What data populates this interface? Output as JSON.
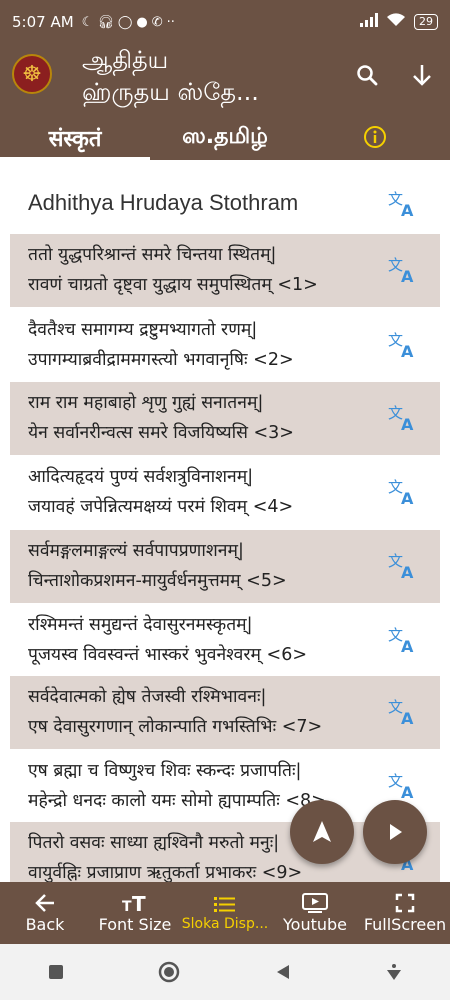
{
  "status_bar": {
    "time": "5:07 AM",
    "battery": "29"
  },
  "app_bar": {
    "title_line1": "ஆதித்ய",
    "title_line2": "ஹ்ருதய ஸ்தே..."
  },
  "tabs": [
    {
      "label": "संस्कृतं",
      "active": true
    },
    {
      "label": "ஸ.தமிழ்",
      "active": false
    }
  ],
  "heading": "Adhithya Hrudaya Stothram",
  "verses": [
    {
      "line1": "ततो युद्धपरिश्रान्तं समरे चिन्तया स्थितम्|",
      "line2": "रावणं चाग्रतो दृष्ट्वा युद्धाय समुपस्थितम् <1>"
    },
    {
      "line1": "दैवतैश्च समागम्य द्रष्टुमभ्यागतो रणम्|",
      "line2": "उपागम्याब्रवीद्राममगस्त्यो भगवानृषिः <2>"
    },
    {
      "line1": "राम राम महाबाहो शृणु गुह्यं सनातनम्|",
      "line2": "येन सर्वानरीन्वत्स समरे विजयिष्यसि <3>"
    },
    {
      "line1": "आदित्यहृदयं पुण्यं सर्वशत्रुविनाशनम्|",
      "line2": "जयावहं जपेन्नित्यमक्षय्यं परमं शिवम् <4>"
    },
    {
      "line1": "सर्वमङ्गलमाङ्गल्यं सर्वपापप्रणाशनम्|",
      "line2": "चिन्ताशोकप्रशमन-मायुर्वर्धनमुत्तमम् <5>"
    },
    {
      "line1": "रश्मिमन्तं समुद्यन्तं देवासुरनमस्कृतम्|",
      "line2": "पूजयस्व विवस्वन्तं भास्करं भुवनेश्वरम् <6>"
    },
    {
      "line1": "सर्वदेवात्मको ह्येष तेजस्वी रश्मिभावनः|",
      "line2": "एष देवासुरगणान् लोकान्पाति गभस्तिभिः <7>"
    },
    {
      "line1": "एष ब्रह्मा च विष्णुश्च शिवः स्कन्दः प्रजापतिः|",
      "line2": "महेन्द्रो धनदः कालो यमः सोमो ह्यपाम्पतिः <8>"
    },
    {
      "line1": "पितरो वसवः साध्या ह्यश्विनौ मरुतो मनुः|",
      "line2": "वायुर्वह्निः प्रजाप्राण ऋतुकर्ता प्रभाकरः <9>"
    }
  ],
  "bottom_nav": [
    {
      "label": "Back",
      "icon": "arrow-left-icon"
    },
    {
      "label": "Font Size",
      "icon": "font-size-icon"
    },
    {
      "label": "Sloka Disp...",
      "icon": "list-icon",
      "active": true
    },
    {
      "label": "Youtube",
      "icon": "youtube-icon"
    },
    {
      "label": "FullScreen",
      "icon": "fullscreen-icon"
    }
  ],
  "colors": {
    "primary": "#6b5244",
    "shaded_row": "#dfd5d0",
    "accent": "#f5d000",
    "translate_icon": "#3b8fd9"
  }
}
